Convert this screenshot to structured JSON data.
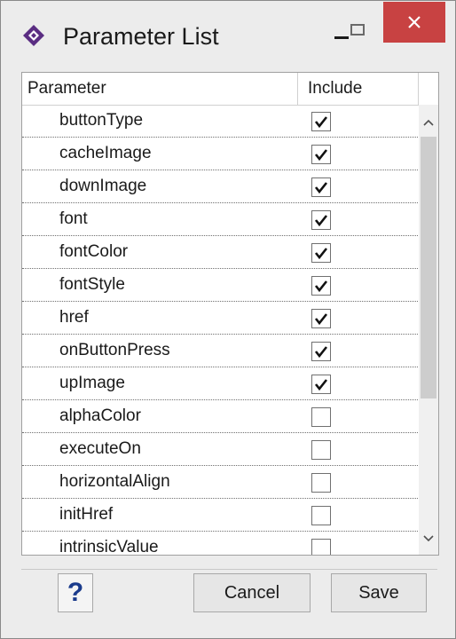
{
  "window": {
    "title": "Parameter List"
  },
  "table": {
    "headers": {
      "parameter": "Parameter",
      "include": "Include"
    },
    "rows": [
      {
        "name": "buttonType",
        "include": true
      },
      {
        "name": "cacheImage",
        "include": true
      },
      {
        "name": "downImage",
        "include": true
      },
      {
        "name": "font",
        "include": true
      },
      {
        "name": "fontColor",
        "include": true
      },
      {
        "name": "fontStyle",
        "include": true
      },
      {
        "name": "href",
        "include": true
      },
      {
        "name": "onButtonPress",
        "include": true
      },
      {
        "name": "upImage",
        "include": true
      },
      {
        "name": "alphaColor",
        "include": false
      },
      {
        "name": "executeOn",
        "include": false
      },
      {
        "name": "horizontalAlign",
        "include": false
      },
      {
        "name": "initHref",
        "include": false
      },
      {
        "name": "intrinsicValue",
        "include": false
      }
    ]
  },
  "buttons": {
    "help": "?",
    "cancel": "Cancel",
    "save": "Save"
  },
  "colors": {
    "close_button": "#c84242",
    "help_icon": "#1a3b8c",
    "app_icon": "#5a2d82"
  }
}
